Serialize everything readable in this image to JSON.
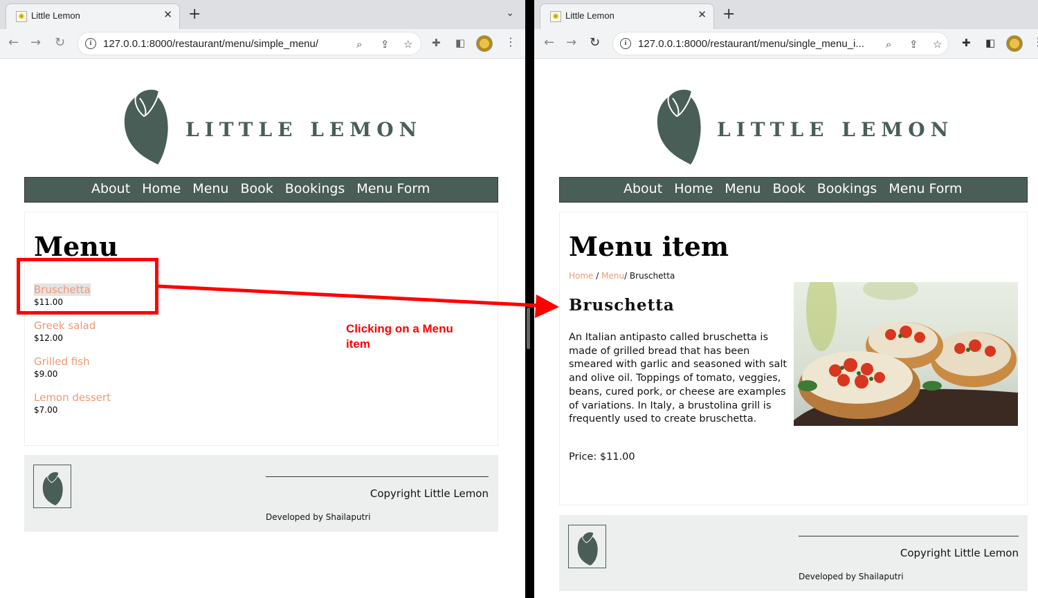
{
  "left": {
    "tab_title": "Little Lemon",
    "url": "127.0.0.1:8000/restaurant/menu/simple_menu/",
    "brand": "LITTLE LEMON",
    "nav": [
      "About",
      "Home",
      "Menu",
      "Book",
      "Bookings",
      "Menu Form"
    ],
    "page_title": "Menu",
    "menu_items": [
      {
        "name": "Bruschetta",
        "price": "$11.00"
      },
      {
        "name": "Greek salad",
        "price": "$12.00"
      },
      {
        "name": "Grilled fish",
        "price": "$9.00"
      },
      {
        "name": "Lemon dessert",
        "price": "$7.00"
      }
    ],
    "footer": {
      "copyright": "Copyright Little Lemon",
      "developed": "Developed by Shailaputri"
    }
  },
  "right": {
    "tab_title": "Little Lemon",
    "url": "127.0.0.1:8000/restaurant/menu/single_menu_i...",
    "brand": "LITTLE LEMON",
    "nav": [
      "About",
      "Home",
      "Menu",
      "Book",
      "Bookings",
      "Menu Form"
    ],
    "page_title": "Menu item",
    "breadcrumb": {
      "home": "Home",
      "sep1": " / ",
      "menu": "Menu",
      "sep2": "/ ",
      "current": "Bruschetta"
    },
    "item": {
      "name": "Bruschetta",
      "description": "An Italian antipasto called bruschetta is made of grilled bread that has been smeared with garlic and seasoned with salt and olive oil. Toppings of tomato, veggies, beans, cured pork, or cheese are examples of variations. In Italy, a brustolina grill is frequently used to create bruschetta.",
      "price": "Price: $11.00"
    },
    "footer": {
      "copyright": "Copyright Little Lemon",
      "developed": "Developed by Shailaputri"
    }
  },
  "annotation": {
    "text": "Clicking on a Menu item"
  },
  "colors": {
    "brand_green": "#495e57",
    "accent_orange": "#ee9972",
    "annotation_red": "#ff0000",
    "footer_bg": "#edefee"
  },
  "icons": [
    "favicon-lemon-icon",
    "close-icon",
    "plus-icon",
    "chevron-down-icon",
    "back-arrow-icon",
    "forward-arrow-icon",
    "reload-icon",
    "info-icon",
    "zoom-icon",
    "share-icon",
    "star-icon",
    "puzzle-icon",
    "sidepanel-icon",
    "kebab-menu-icon",
    "lemon-logo-icon"
  ]
}
